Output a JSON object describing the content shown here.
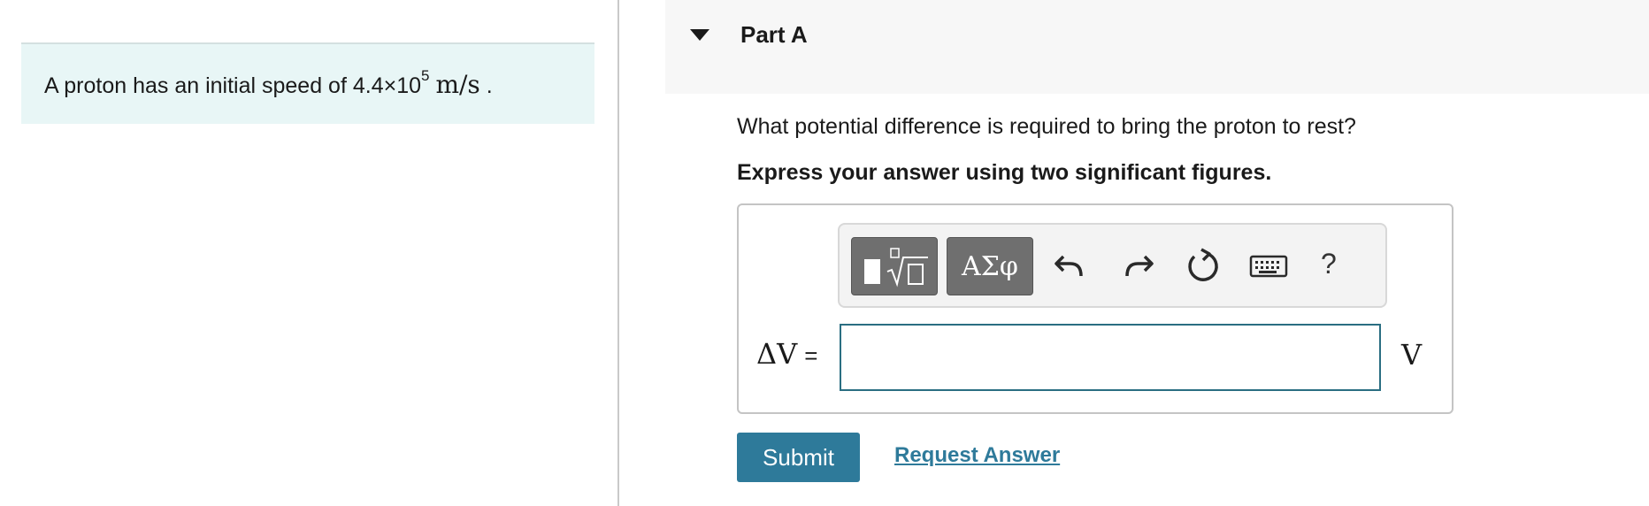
{
  "problem": {
    "text_before": "A proton has an initial speed of 4.4×10",
    "exponent": "5",
    "unit": "m/s",
    "text_after": " ."
  },
  "part": {
    "title": "Part A",
    "question": "What potential difference is required to bring the proton to rest?",
    "instruction": "Express your answer using two significant figures."
  },
  "toolbar": {
    "symbols_label": "ΑΣφ",
    "help_label": "?",
    "icons": [
      "templates-icon",
      "undo-icon",
      "redo-icon",
      "reset-icon",
      "keyboard-icon"
    ]
  },
  "answer": {
    "variable": "ΔV",
    "equals": "=",
    "value": "",
    "unit": "V"
  },
  "actions": {
    "submit_label": "Submit",
    "request_label": "Request Answer"
  },
  "colors": {
    "accent": "#2e7a9a",
    "problem_bg": "#e8f6f6",
    "input_border": "#2a6e82"
  }
}
